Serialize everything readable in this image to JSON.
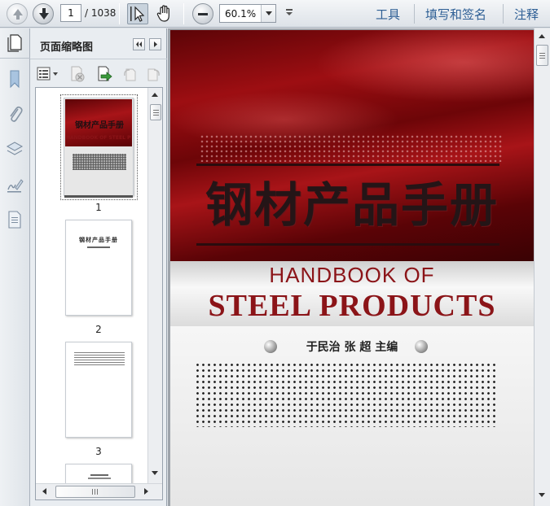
{
  "toolbar": {
    "prev_page_icon": "arrow-up-icon",
    "next_page_icon": "arrow-down-icon",
    "current_page": "1",
    "total_pages": "/ 1038",
    "select_tool_icon": "select-cursor-icon",
    "hand_tool_icon": "hand-icon",
    "zoom_out_icon": "minus-icon",
    "zoom_value": "60.1%",
    "links": {
      "tools": "工具",
      "fill_sign": "填写和签名",
      "comment": "注释"
    }
  },
  "rail": {
    "icons": [
      "bookmark-icon",
      "attachment-icon",
      "layers-icon",
      "signature-icon",
      "page-icon"
    ]
  },
  "panel": {
    "title": "页面缩略图",
    "thumbnails": [
      {
        "number": "1",
        "title": "钢材产品手册",
        "subtitle": "HANDBOOK OF STEEL PRODUCTS"
      },
      {
        "number": "2",
        "title": "钢材产品手册"
      },
      {
        "number": "3"
      }
    ]
  },
  "cover": {
    "title_cn": "钢材产品手册",
    "title_en_line1": "HANDBOOK OF",
    "title_en_line2": "STEEL PRODUCTS",
    "editors": "于民治 张 超 主编"
  },
  "colors": {
    "accent_link": "#2e5f95",
    "cover_red": "#8b1418"
  }
}
